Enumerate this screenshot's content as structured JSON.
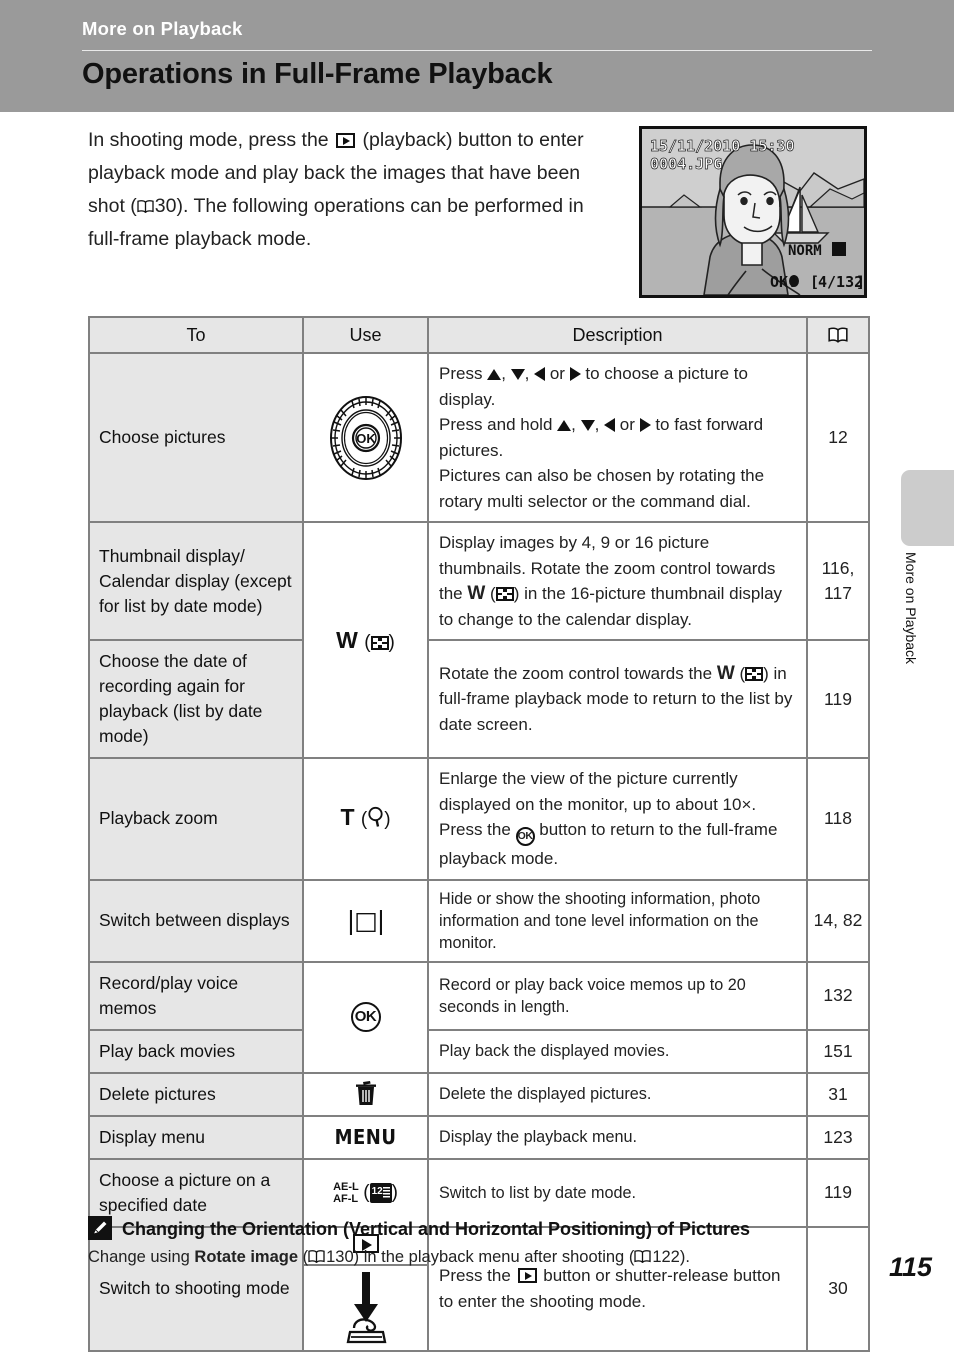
{
  "header": {
    "kicker": "More on Playback",
    "title": "Operations in Full-Frame Playback"
  },
  "intro": {
    "part1": "In shooting mode, press the",
    "icon1": "playback-button-icon",
    "part2": "(playback) button to enter playback mode and play back the images that have been shot (",
    "icon2": "book-icon",
    "ref1": "30",
    "part3": "). The following operations can be performed in full-frame playback mode."
  },
  "camera_screen": {
    "datetime": "15/11/2010 15:30",
    "filename": "0004.JPG",
    "quality": "NORM",
    "ok_hint": "OK:",
    "frame_counter": "4/132"
  },
  "side_tab": {
    "label": "More on Playback"
  },
  "table": {
    "headers": {
      "to": "To",
      "use": "Use",
      "description": "Description",
      "page": "book-icon"
    },
    "rows": [
      {
        "to": "Choose pictures",
        "use_icon": "rotary-multi-selector-dial",
        "desc_lines": [
          "Press ▲, ▼, ◀ or ▶ to choose a picture to display.",
          "Press and hold ▲, ▼, ◀ or ▶ to fast forward pictures.",
          "Pictures can also be chosen by rotating the rotary multi selector or the command dial."
        ],
        "page": "12"
      },
      {
        "to": "Thumbnail display/ Calendar display (except for list by date mode)",
        "use_icon": "zoom-wide-thumbnail",
        "use_label": "W",
        "desc": "Display images by 4, 9 or 16 picture thumbnails. Rotate the zoom control towards the W (thumbnail) in the 16-picture thumbnail display to change to the calendar display.",
        "page": "116, 117"
      },
      {
        "to": "Choose the date of recording again for playback (list by date mode)",
        "desc": "Rotate the zoom control towards the W (thumbnail) in full-frame playback mode to return to the list by date screen.",
        "page": "119"
      },
      {
        "to": "Playback zoom",
        "use_icon": "zoom-tele-magnifier",
        "use_label": "T",
        "desc": "Enlarge the view of the picture currently displayed on the monitor, up to about 10×. Press the OK button to return to the full-frame playback mode.",
        "page": "118"
      },
      {
        "to": "Switch between displays",
        "use_icon": "display-mode-icon",
        "desc": "Hide or show the shooting information, photo information and tone level information on the monitor.",
        "page": "14, 82"
      },
      {
        "to": "Record/play voice memos",
        "use_icon": "ok-button-icon",
        "desc": "Record or play back voice memos up to 20 seconds in length.",
        "page": "132"
      },
      {
        "to": "Play back movies",
        "desc": "Play back the displayed movies.",
        "page": "151"
      },
      {
        "to": "Delete pictures",
        "use_icon": "trash-can-icon",
        "desc": "Delete the displayed pictures.",
        "page": "31"
      },
      {
        "to": "Display menu",
        "use_icon": "menu-button-icon",
        "use_label": "MENU",
        "desc": "Display the playback menu.",
        "page": "123"
      },
      {
        "to": "Choose a picture on a specified date",
        "use_icon": "ae-l-af-l-calendar-icon",
        "use_label": "AE-L AF-L",
        "desc": "Switch to list by date mode.",
        "page": "119"
      },
      {
        "to": "Switch to shooting mode",
        "use_icon": "playback-button-then-shutter-release",
        "desc": "Press the ▶ button or shutter-release button to enter the shooting mode.",
        "page": "30"
      }
    ]
  },
  "note": {
    "icon": "pencil-note-icon",
    "heading": "Changing the Orientation (Vertical and Horizontal Positioning) of Pictures",
    "body_part1": "Change using",
    "body_bold": "Rotate image",
    "body_part2": "(",
    "ref1": "130",
    "body_part3": ") in the playback menu after shooting (",
    "ref2": "122",
    "body_part4": ")."
  },
  "folio": "115",
  "colors": {
    "header_band": "#9a9a9a",
    "table_grid": "#808080",
    "to_column_bg": "#e6e6e6",
    "side_tab": "#cccccc"
  }
}
